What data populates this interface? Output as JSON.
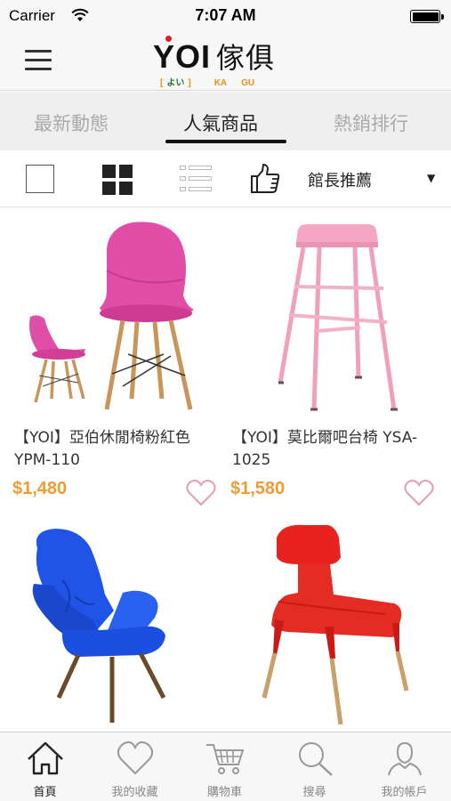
{
  "status_bar": {
    "carrier": "Carrier",
    "time": "7:07 AM"
  },
  "header": {
    "logo_main": "YOI",
    "logo_cjk": "傢俱",
    "logo_sub_left_bracket": "[",
    "logo_sub_jp": "よい",
    "logo_sub_right_bracket": "]",
    "logo_sub_ka": "KA",
    "logo_sub_gu": "GU"
  },
  "tabs": [
    {
      "label": "最新動態",
      "active": false
    },
    {
      "label": "人氣商品",
      "active": true
    },
    {
      "label": "熱銷排行",
      "active": false
    }
  ],
  "toolbar": {
    "sort_label": "館長推薦",
    "sort_arrow": "▼",
    "active_view": "grid"
  },
  "products": [
    {
      "name": "【YOI】亞伯休閒椅粉紅色 YPM-110",
      "price": "$1,480",
      "image": "pink-eames-chair"
    },
    {
      "name": "【YOI】莫比爾吧台椅 YSA-1025",
      "price": "$1,580",
      "image": "pink-bar-stool"
    },
    {
      "name": "",
      "price": "",
      "image": "blue-wingback-chair"
    },
    {
      "name": "",
      "price": "",
      "image": "red-dining-chair"
    }
  ],
  "tab_bar": [
    {
      "label": "首頁",
      "icon": "home-icon",
      "active": true
    },
    {
      "label": "我的收藏",
      "icon": "heart-icon",
      "active": false
    },
    {
      "label": "購物車",
      "icon": "cart-icon",
      "active": false
    },
    {
      "label": "搜尋",
      "icon": "search-icon",
      "active": false
    },
    {
      "label": "我的帳戶",
      "icon": "account-icon",
      "active": false
    }
  ],
  "colors": {
    "price": "#f39c33",
    "logo_dot": "#e02020",
    "logo_accent": "#e8901a",
    "logo_green": "#1a7a2a"
  }
}
